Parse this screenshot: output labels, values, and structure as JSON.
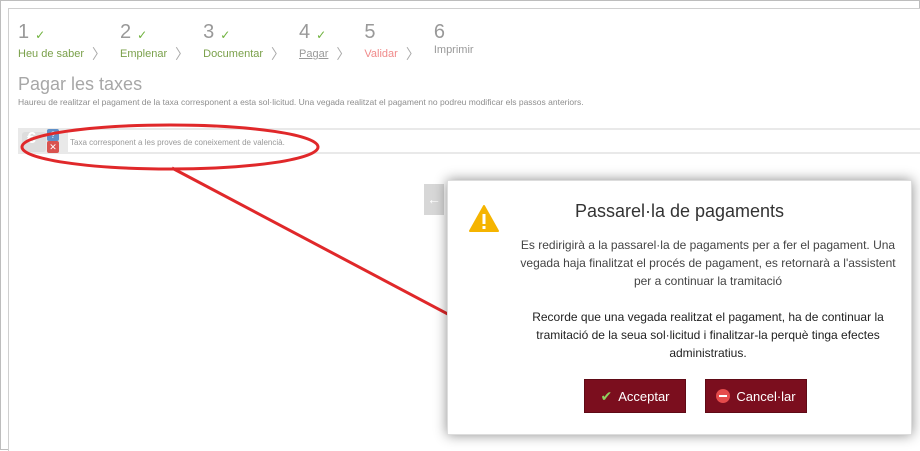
{
  "wizard": {
    "steps": [
      {
        "num": "1",
        "check": "✓",
        "label": "Heu de saber"
      },
      {
        "num": "2",
        "check": "✓",
        "label": "Emplenar"
      },
      {
        "num": "3",
        "check": "✓",
        "label": "Documentar"
      },
      {
        "num": "4",
        "check": "✓",
        "label": "Pagar"
      },
      {
        "num": "5",
        "check": "",
        "label": "Validar"
      },
      {
        "num": "6",
        "check": "",
        "label": "Imprimir"
      }
    ],
    "separator": "〉"
  },
  "page": {
    "title": "Pagar les taxes",
    "description": "Haureu de realitzar el pagament de la taxa corresponent a esta sol·licitud. Una vegada realitzat el pagament no podreu modificar els passos anteriors."
  },
  "fee": {
    "text": "Taxa corresponent a les proves de coneixement de valencià.",
    "euro_symbol": "€",
    "q_symbol": "?",
    "x_symbol": "✕"
  },
  "back_arrow": "←",
  "modal": {
    "title": "Passarel·la de pagaments",
    "paragraph1": "Es redirigirà a la passarel·la de pagaments per a fer el pagament. Una vegada haja finalitzat el procés de pagament, es retornarà a l'assistent per a continuar la tramitació",
    "paragraph2": "Recorde que una vegada realitzat el pagament, ha de continuar la tramitació de la seua sol·licitud i finalitzar-la perquè tinga efectes administratius.",
    "accept_label": "Acceptar",
    "cancel_label": "Cancel·lar",
    "accept_icon": "✔"
  },
  "colors": {
    "button_bg": "#7b0e1e",
    "annotation": "#e0282a",
    "warning": "#f5b400",
    "completed_step": "#7aa04a",
    "active_step": "#f08a8a"
  }
}
